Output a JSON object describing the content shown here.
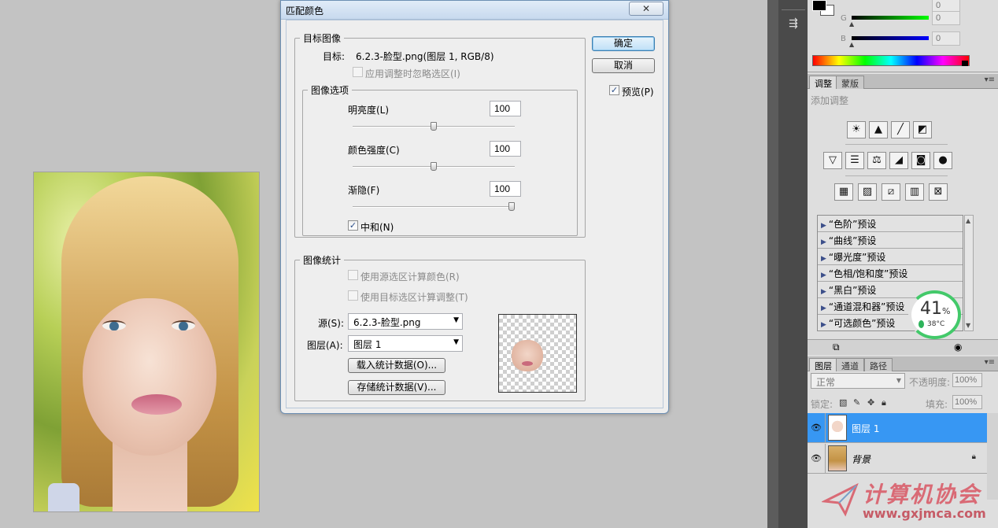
{
  "dialog": {
    "title": "匹配颜色",
    "close_label": "✕",
    "target_group": {
      "legend": "目标图像",
      "target_label": "目标:",
      "target_value": "6.2.3-脸型.png(图层 1, RGB/8)",
      "ignore_selection_label": "应用调整时忽略选区(I)"
    },
    "image_options": {
      "legend": "图像选项",
      "luminance_label": "明亮度(L)",
      "luminance_value": "100",
      "luminance_fraction": 0.5,
      "color_intensity_label": "颜色强度(C)",
      "color_intensity_value": "100",
      "color_intensity_fraction": 0.5,
      "fade_label": "渐隐(F)",
      "fade_value": "100",
      "fade_fraction": 1.0,
      "neutralize_label": "中和(N)",
      "neutralize_checked": true
    },
    "image_stats": {
      "legend": "图像统计",
      "use_source_sel_label": "使用源选区计算颜色(R)",
      "use_target_sel_label": "使用目标选区计算调整(T)",
      "source_label": "源(S):",
      "source_value": "6.2.3-脸型.png",
      "layer_label": "图层(A):",
      "layer_value": "图层 1",
      "load_stats_label": "载入统计数据(O)...",
      "save_stats_label": "存储统计数据(V)..."
    },
    "ok_label": "确定",
    "cancel_label": "取消",
    "preview_label": "预览(P)",
    "preview_checked": true
  },
  "color_panel": {
    "g_label": "G",
    "b_label": "B",
    "g_value": "0",
    "b_value": "0",
    "top_value": "0"
  },
  "adjustments_panel": {
    "tabs": [
      "调整",
      "蒙版"
    ],
    "title": "添加调整",
    "presets": [
      "“色阶”预设",
      "“曲线”预设",
      "“曝光度”预设",
      "“色相/饱和度”预设",
      "“黑白”预设",
      "“通道混和器”预设",
      "“可选颜色”预设"
    ]
  },
  "gauge": {
    "value": "41",
    "unit": "%",
    "temp": "38°C"
  },
  "layers_panel": {
    "tabs": [
      "图层",
      "通道",
      "路径"
    ],
    "blend_mode": "正常",
    "opacity_label": "不透明度:",
    "opacity_value": "100%",
    "lock_label": "锁定:",
    "fill_label": "填充:",
    "fill_value": "100%",
    "layers": [
      {
        "name": "图层 1",
        "selected": true
      },
      {
        "name": "背景",
        "selected": false
      }
    ]
  },
  "watermark": {
    "text": "计算机协会",
    "url": "www.gxjmca.com"
  },
  "colors": {
    "selected_layer": "#3797f3",
    "dialog_title": "#c7d9ee",
    "gauge": "#43c96a"
  }
}
